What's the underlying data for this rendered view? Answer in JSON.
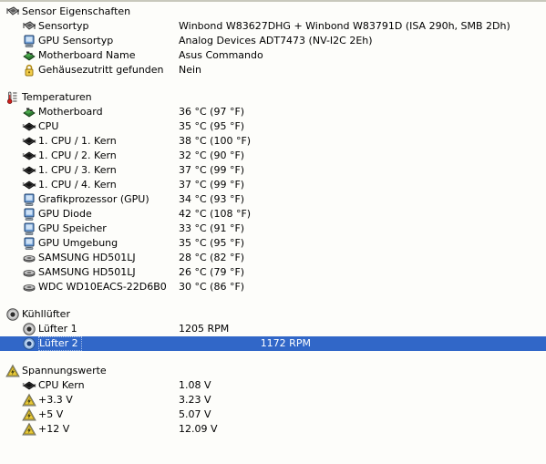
{
  "window": {
    "title": "Sensor Eigenschaften",
    "selection_color": "#3167c8",
    "background_color": "#fdfdfa"
  },
  "sections": [
    {
      "id": "sensor-properties",
      "title": "Sensor Eigenschaften",
      "icon": "chip-icon",
      "rows": [
        {
          "icon": "chip-icon",
          "label": "Sensortyp",
          "value": "Winbond W83627DHG + Winbond W83791D  (ISA 290h, SMB 2Dh)"
        },
        {
          "icon": "gpu-monitor-icon",
          "label": "GPU Sensortyp",
          "value": "Analog Devices ADT7473  (NV-I2C 2Eh)"
        },
        {
          "icon": "motherboard-icon",
          "label": "Motherboard Name",
          "value": "Asus Commando"
        },
        {
          "icon": "lock-icon",
          "label": "Gehäusezutritt gefunden",
          "value": "Nein"
        }
      ]
    },
    {
      "id": "temperatures",
      "title": "Temperaturen",
      "icon": "thermometer-icon",
      "rows": [
        {
          "icon": "motherboard-icon",
          "label": "Motherboard",
          "value": "36 °C  (97 °F)"
        },
        {
          "icon": "cpu-icon",
          "label": "CPU",
          "value": "35 °C  (95 °F)"
        },
        {
          "icon": "cpu-icon",
          "label": "1. CPU / 1. Kern",
          "value": "38 °C  (100 °F)"
        },
        {
          "icon": "cpu-icon",
          "label": "1. CPU / 2. Kern",
          "value": "32 °C  (90 °F)"
        },
        {
          "icon": "cpu-icon",
          "label": "1. CPU / 3. Kern",
          "value": "37 °C  (99 °F)"
        },
        {
          "icon": "cpu-icon",
          "label": "1. CPU / 4. Kern",
          "value": "37 °C  (99 °F)"
        },
        {
          "icon": "gpu-monitor-icon",
          "label": "Grafikprozessor (GPU)",
          "value": "34 °C  (93 °F)"
        },
        {
          "icon": "gpu-monitor-icon",
          "label": "GPU Diode",
          "value": "42 °C  (108 °F)"
        },
        {
          "icon": "gpu-monitor-icon",
          "label": "GPU Speicher",
          "value": "33 °C  (91 °F)"
        },
        {
          "icon": "gpu-monitor-icon",
          "label": "GPU Umgebung",
          "value": "35 °C  (95 °F)"
        },
        {
          "icon": "harddisk-icon",
          "label": "SAMSUNG HD501LJ",
          "value": "28 °C  (82 °F)"
        },
        {
          "icon": "harddisk-icon",
          "label": "SAMSUNG HD501LJ",
          "value": "26 °C  (79 °F)"
        },
        {
          "icon": "harddisk-icon",
          "label": "WDC WD10EACS-22D6B0",
          "value": "30 °C  (86 °F)"
        }
      ]
    },
    {
      "id": "fans",
      "title": "Kühllüfter",
      "icon": "fan-icon",
      "rows": [
        {
          "icon": "fan-icon",
          "label": "Lüfter 1",
          "value": "1205 RPM",
          "selected": false
        },
        {
          "icon": "fan-selected-icon",
          "label": "Lüfter 2",
          "value": "1172 RPM",
          "selected": true
        }
      ]
    },
    {
      "id": "voltages",
      "title": "Spannungswerte",
      "icon": "voltage-icon",
      "rows": [
        {
          "icon": "cpu-icon",
          "label": "CPU Kern",
          "value": "1.08 V"
        },
        {
          "icon": "voltage-icon",
          "label": "+3.3 V",
          "value": "3.23 V"
        },
        {
          "icon": "voltage-icon",
          "label": "+5 V",
          "value": "5.07 V"
        },
        {
          "icon": "voltage-icon",
          "label": "+12 V",
          "value": "12.09 V"
        }
      ]
    }
  ]
}
